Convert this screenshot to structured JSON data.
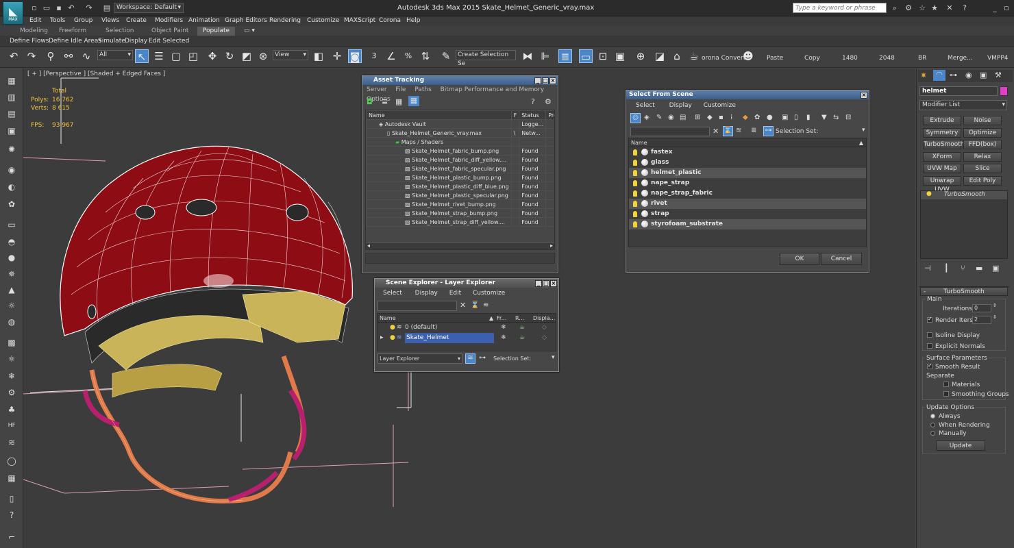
{
  "app": {
    "title": "Autodesk 3ds Max  2015     Skate_Helmet_Generic_vray.max",
    "logo_text": "MAX",
    "workspace_label": "Workspace: Default",
    "search_placeholder": "Type a keyword or phrase"
  },
  "menu": [
    "Edit",
    "Tools",
    "Group",
    "Views",
    "Create",
    "Modifiers",
    "Animation",
    "Graph Editors",
    "Rendering",
    "Customize",
    "MAXScript",
    "Corona",
    "Help"
  ],
  "ribbon": {
    "tabs": [
      "Modeling",
      "Freeform",
      "Selection",
      "Object Paint",
      "Populate"
    ],
    "active_tab": "Populate",
    "sub": [
      "Define Flows",
      "Define Idle Areas",
      "Simulate",
      "Display",
      "Edit Selected"
    ]
  },
  "toolbar": {
    "filter_value": "All",
    "view_value": "View",
    "selection_set": "Create Selection Se",
    "corona_convert": "orona Convert",
    "paste": "Paste",
    "copy": "Copy",
    "width": "1480",
    "height": "2048",
    "br": "BR",
    "merge": "Merge...",
    "vmpp": "VMPP4"
  },
  "viewport": {
    "label": "[ + ] [Perspective ] [Shaded + Edged Faces ]",
    "stats": {
      "total_label": "Total",
      "polys_label": "Polys:",
      "polys_value": "16 762",
      "verts_label": "Verts:",
      "verts_value": "8 615",
      "fps_label": "FPS:",
      "fps_value": "93,967"
    }
  },
  "asset_tracking": {
    "title": "Asset Tracking",
    "menu": [
      "Server",
      "File",
      "Paths",
      "Bitmap Performance and Memory",
      "Options"
    ],
    "columns": [
      "Name",
      "F",
      "Status",
      "Pro"
    ],
    "rows": [
      {
        "name": "Autodesk Vault",
        "f": "",
        "status": "Logge..."
      },
      {
        "name": "Skate_Helmet_Generic_vray.max",
        "f": "\\",
        "status": "Netw..."
      },
      {
        "name": "Maps / Shaders",
        "f": "",
        "status": ""
      },
      {
        "name": "Skate_Helmet_fabric_bump.png",
        "f": "",
        "status": "Found"
      },
      {
        "name": "Skate_Helmet_fabric_diff_yellow....",
        "f": "",
        "status": "Found"
      },
      {
        "name": "Skate_Helmet_fabric_specular.png",
        "f": "",
        "status": "Found"
      },
      {
        "name": "Skate_Helmet_plastic_bump.png",
        "f": "",
        "status": "Found"
      },
      {
        "name": "Skate_Helmet_plastic_diff_blue.png",
        "f": "",
        "status": "Found"
      },
      {
        "name": "Skate_Helmet_plastic_specular.png",
        "f": "",
        "status": "Found"
      },
      {
        "name": "Skate_Helmet_rivet_bump.png",
        "f": "",
        "status": "Found"
      },
      {
        "name": "Skate_Helmet_strap_bump.png",
        "f": "",
        "status": "Found"
      },
      {
        "name": "Skate_Helmet_strap_diff_yellow....",
        "f": "",
        "status": "Found"
      }
    ]
  },
  "select_from_scene": {
    "title": "Select From Scene",
    "menu": [
      "Select",
      "Display",
      "Customize"
    ],
    "selection_set_label": "Selection Set:",
    "column": "Name",
    "items": [
      "fastex",
      "glass",
      "helmet_plastic",
      "nape_strap",
      "nape_strap_fabric",
      "rivet",
      "strap",
      "styrofoam_substrate"
    ],
    "ok": "OK",
    "cancel": "Cancel"
  },
  "scene_explorer": {
    "title": "Scene Explorer - Layer Explorer",
    "menu": [
      "Select",
      "Display",
      "Edit",
      "Customize"
    ],
    "columns": [
      "Name",
      "Fr...",
      "R...",
      "Displa..."
    ],
    "layers": [
      "0 (default)",
      "Skate_Helmet"
    ],
    "footer_dropdown": "Layer Explorer",
    "selection_set_label": "Selection Set:"
  },
  "command_panel": {
    "object_name": "helmet",
    "object_color": "#e040c8",
    "modifier_list": "Modifier List",
    "buttons": [
      "Extrude",
      "Noise",
      "Symmetry",
      "Optimize",
      "TurboSmooth",
      "FFD(box)",
      "XForm",
      "Relax",
      "UVW Map",
      "Slice",
      "Unwrap UVW",
      "Edit Poly"
    ],
    "stack_item": "TurboSmooth",
    "rollout_title": "TurboSmooth",
    "main_label": "Main",
    "iterations_label": "Iterations:",
    "iterations_value": "0",
    "render_iters_label": "Render Iters:",
    "render_iters_value": "2",
    "isoline_display": "Isoline Display",
    "explicit_normals": "Explicit Normals",
    "surface_params": "Surface Parameters",
    "smooth_result": "Smooth Result",
    "separate": "Separate",
    "materials": "Materials",
    "smoothing_groups": "Smoothing Groups",
    "update_options": "Update Options",
    "always": "Always",
    "when_rendering": "When Rendering",
    "manually": "Manually",
    "update_button": "Update"
  },
  "colors": {
    "helmet_shell": "#8e0d14",
    "padding": "#c9b45a",
    "strap": "#e07a4a",
    "accent_blue": "#4a86c8"
  }
}
